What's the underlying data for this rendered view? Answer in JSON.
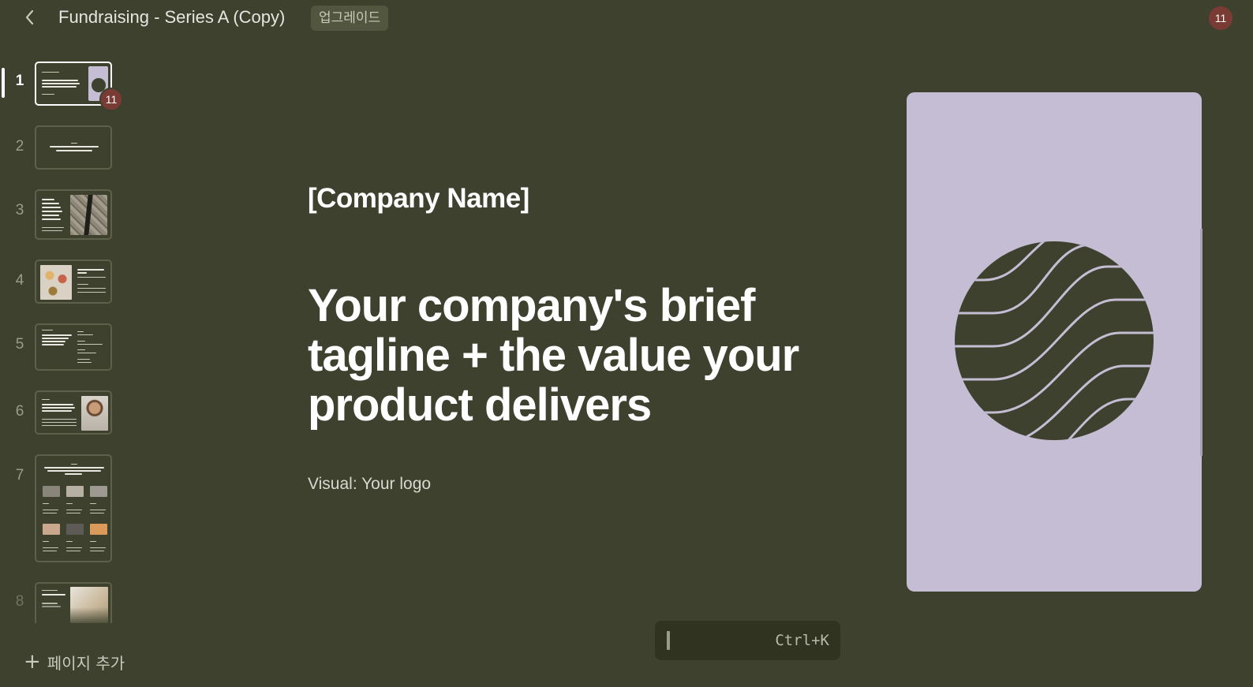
{
  "header": {
    "title": "Fundraising - Series A (Copy)",
    "upgrade_label": "업그레이드",
    "user_count": "11"
  },
  "sidebar": {
    "pages": [
      {
        "number": "1",
        "active": true
      },
      {
        "number": "2"
      },
      {
        "number": "3"
      },
      {
        "number": "4"
      },
      {
        "number": "5"
      },
      {
        "number": "6"
      },
      {
        "number": "7"
      },
      {
        "number": "8"
      }
    ],
    "thumb_badge": "11",
    "add_page_label": "페이지 추가"
  },
  "slide": {
    "company_name": "[Company Name]",
    "tagline": "Your company's brief tagline + the value your product delivers",
    "visual_note": "Visual: Your logo"
  },
  "command": {
    "shortcut": "Ctrl+K"
  },
  "icons": {
    "back": "chevron-left-icon",
    "add": "plus-icon",
    "logo": "wave-globe-logo"
  },
  "colors": {
    "background": "#3d412e",
    "card": "#c4bdd3",
    "logo_fill": "#3d412e",
    "badge": "#7a3b35"
  }
}
